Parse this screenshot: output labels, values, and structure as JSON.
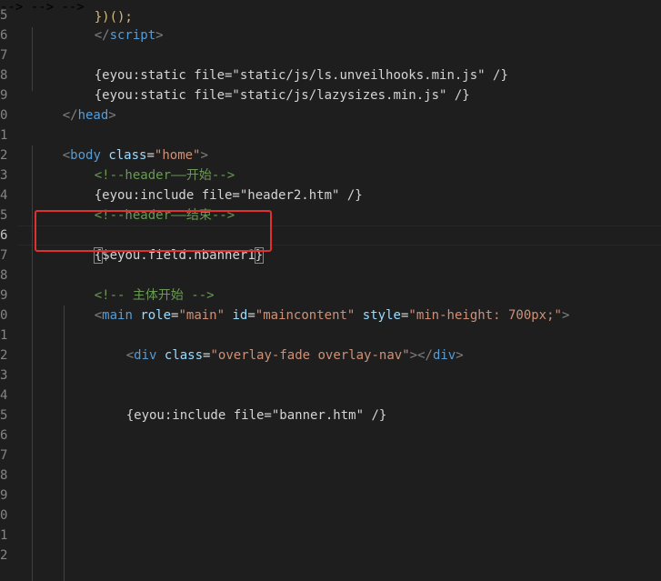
{
  "editor": {
    "line_numbers": [
      "5",
      "6",
      "7",
      "8",
      "9",
      "0",
      "1",
      "2",
      "3",
      "4",
      "5",
      "6",
      "7",
      "8",
      "9",
      "0",
      "1",
      "2",
      "3",
      "4",
      "5",
      "6",
      "7",
      "8",
      "9",
      "0",
      "1",
      "2"
    ],
    "active_line_number": "6",
    "partial_top_line": "})();",
    "lines": {
      "l1": {
        "close": "</",
        "tag": "script",
        "end": ">"
      },
      "l3": {
        "text": "{eyou:static file=\"static/js/ls.unveilhooks.min.js\" /}"
      },
      "l4": {
        "text": "{eyou:static file=\"static/js/lazysizes.min.js\" /}"
      },
      "l5": {
        "close": "</",
        "tag": "head",
        "end": ">"
      },
      "l7": {
        "open": "<",
        "tag": "body",
        "attr": "class",
        "eq": "=",
        "value": "\"home\"",
        "end": ">"
      },
      "l8": {
        "comment": "<!--header——开始-->"
      },
      "l9": {
        "text": "{eyou:include file=\"header2.htm\" /}"
      },
      "l10": {
        "comment": "<!--header——结束-->"
      },
      "l12": {
        "open_brace": "{",
        "text": "$eyou.field.nbanner1",
        "close_brace": "}"
      },
      "l14": {
        "comment": "<!-- 主体开始 -->"
      },
      "l15": {
        "open": "<",
        "tag": "main",
        "attr1": "role",
        "val1": "\"main\"",
        "attr2": "id",
        "val2": "\"maincontent\"",
        "attr3": "style",
        "val3": "\"min-height: 700px;\"",
        "end": ">"
      },
      "l17": {
        "open": "<",
        "tag": "div",
        "attr": "class",
        "value": "\"overlay-fade overlay-nav\"",
        "mid": "></",
        "tag2": "div",
        "end": ">"
      },
      "l20": {
        "text": "{eyou:include file=\"banner.htm\" /}"
      }
    }
  },
  "colors": {
    "background": "#1e1e1e",
    "tag": "#569cd6",
    "attribute": "#9cdcfe",
    "string": "#ce9178",
    "comment": "#6a9955",
    "text": "#d4d4d4",
    "highlight_box": "#e03030"
  }
}
